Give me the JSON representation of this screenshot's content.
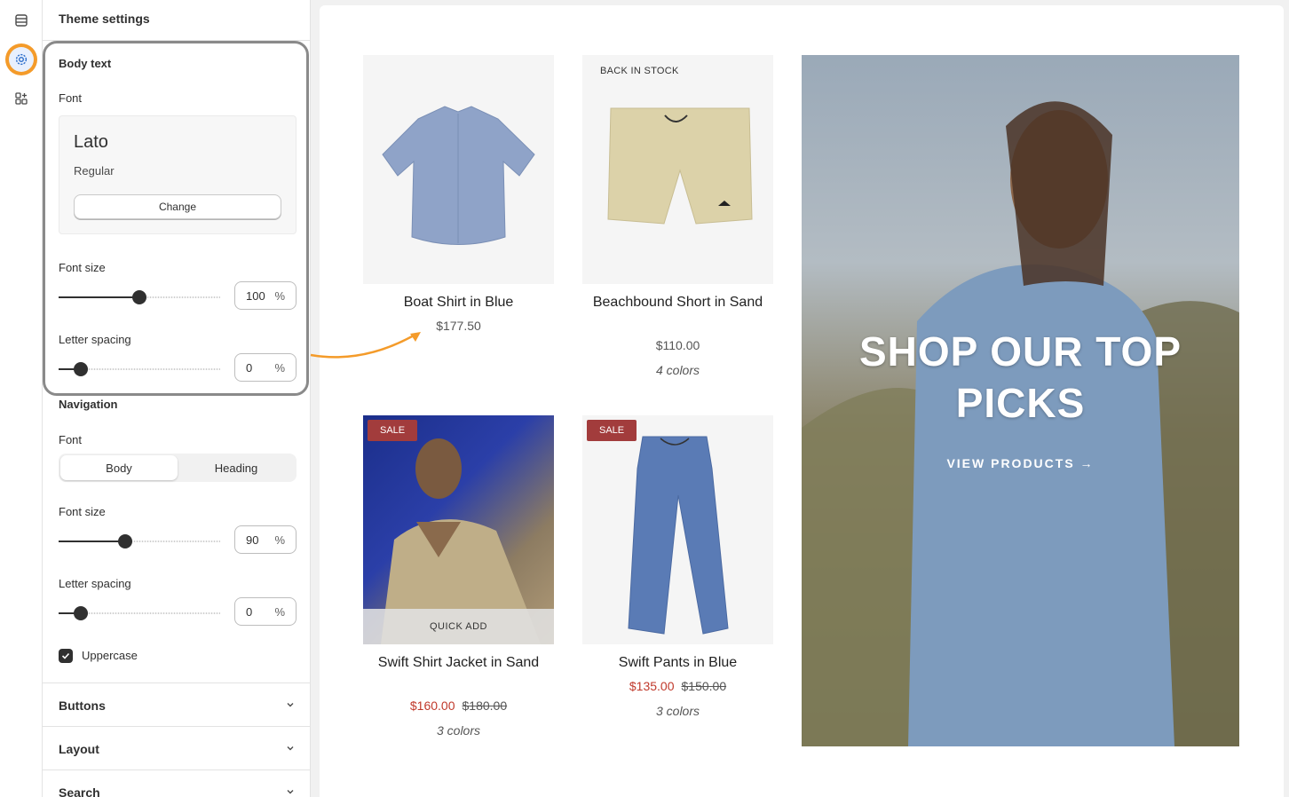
{
  "panel": {
    "title": "Theme settings",
    "body_text": {
      "heading": "Body text",
      "font_label": "Font",
      "font_name": "Lato",
      "font_style": "Regular",
      "change_label": "Change",
      "font_size_label": "Font size",
      "font_size_value": "100",
      "font_size_slider": 0.5,
      "letter_spacing_label": "Letter spacing",
      "letter_spacing_value": "0",
      "letter_spacing_slider": 0.14,
      "unit": "%"
    },
    "navigation": {
      "heading": "Navigation",
      "font_label": "Font",
      "font_options": [
        "Body",
        "Heading"
      ],
      "font_selected": "Body",
      "font_size_label": "Font size",
      "font_size_value": "90",
      "font_size_slider": 0.41,
      "letter_spacing_label": "Letter spacing",
      "letter_spacing_value": "0",
      "letter_spacing_slider": 0.14,
      "unit": "%",
      "uppercase_label": "Uppercase",
      "uppercase_checked": true
    },
    "accordions": [
      "Buttons",
      "Layout",
      "Search"
    ]
  },
  "preview": {
    "products": [
      {
        "name": "Boat Shirt in Blue",
        "price": "$177.50"
      },
      {
        "name": "Beachbound Short in Sand",
        "badge": "BACK IN STOCK",
        "price": "$110.00",
        "colors": "4 colors"
      },
      {
        "name": "Swift Shirt Jacket in Sand",
        "badge": "SALE",
        "sale_price": "$160.00",
        "old_price": "$180.00",
        "colors": "3 colors",
        "quick_add": "QUICK ADD"
      },
      {
        "name": "Swift Pants in Blue",
        "badge": "SALE",
        "sale_price": "$135.00",
        "old_price": "$150.00",
        "colors": "3 colors"
      }
    ],
    "hero": {
      "title": "SHOP OUR TOP PICKS",
      "link": "VIEW PRODUCTS →"
    }
  },
  "colors": {
    "accent_ring": "#f49b2a",
    "sale_badge": "#a23c3c",
    "sale_price": "#c0392b",
    "arrow": "#f49b2a"
  }
}
